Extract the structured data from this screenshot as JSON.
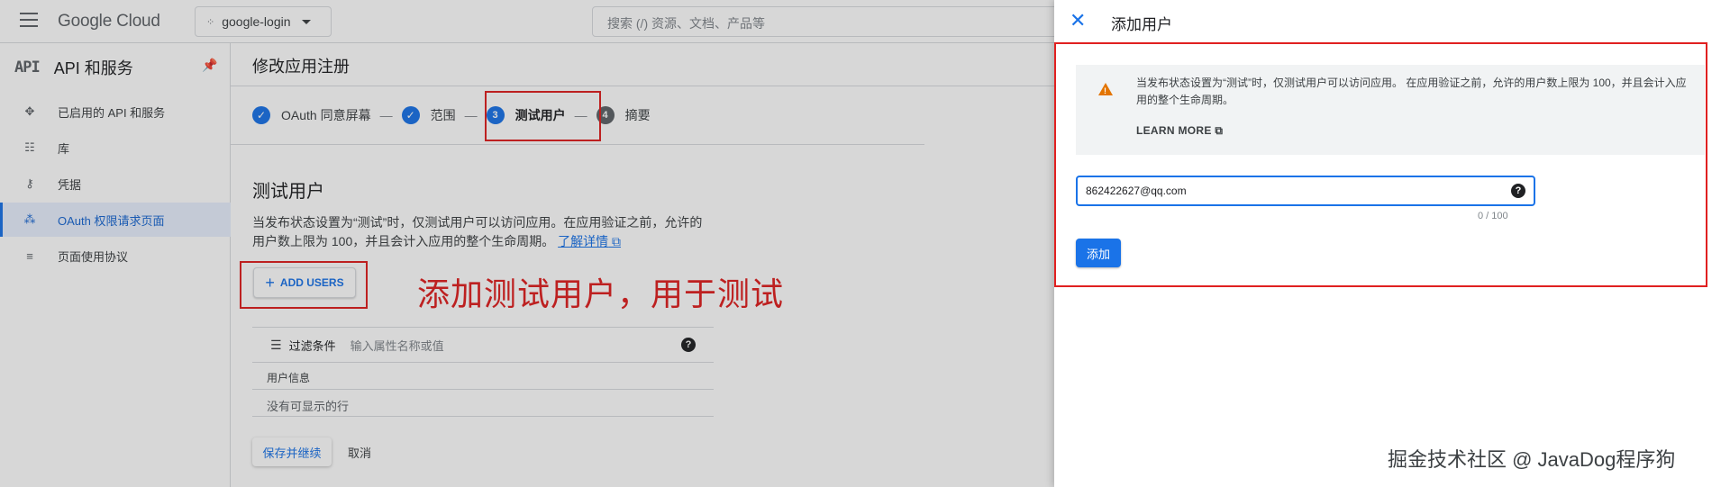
{
  "header": {
    "logo": "Google Cloud",
    "project": "google-login",
    "search_placeholder": "搜索 (/) 资源、文档、产品等"
  },
  "sidebar": {
    "title": "API 和服务",
    "logo_text": "API",
    "items": [
      {
        "label": "已启用的 API 和服务",
        "icon": "dashboard-icon"
      },
      {
        "label": "库",
        "icon": "library-icon"
      },
      {
        "label": "凭据",
        "icon": "key-icon"
      },
      {
        "label": "OAuth 权限请求页面",
        "icon": "oauth-consent-icon",
        "active": true
      },
      {
        "label": "页面使用协议",
        "icon": "page-agreement-icon"
      }
    ]
  },
  "main": {
    "page_title": "修改应用注册",
    "steps": [
      {
        "label": "OAuth 同意屏幕",
        "status": "done"
      },
      {
        "label": "范围",
        "status": "done"
      },
      {
        "num": "3",
        "label": "测试用户",
        "status": "current"
      },
      {
        "num": "4",
        "label": "摘要",
        "status": "pending"
      }
    ],
    "section_title": "测试用户",
    "description": "当发布状态设置为“测试”时，仅测试用户可以访问应用。在应用验证之前，允许的用户数上限为 100，并且会计入应用的整个生命周期。",
    "learn_more_link": "了解详情",
    "add_users_label": "ADD USERS",
    "annotation": "添加测试用户，用于测试",
    "filter_label": "过滤条件",
    "filter_placeholder": "输入属性名称或值",
    "table_header": "用户信息",
    "empty_text": "没有可显示的行",
    "save_label": "保存并继续",
    "cancel_label": "取消"
  },
  "drawer": {
    "title": "添加用户",
    "notice": "当发布状态设置为“测试”时，仅测试用户可以访问应用。 在应用验证之前，允许的用户数上限为 100，并且会计入应用的整个生命周期。",
    "learn_more": "LEARN MORE",
    "email_value": "862422627@qq.com",
    "counter": "0 / 100",
    "add_label": "添加"
  },
  "watermark": "掘金技术社区 @ JavaDog程序狗",
  "colors": {
    "accent": "#1a73e8",
    "annotation_red": "#e02020",
    "warning": "#e37400",
    "step_pending": "#5f6368"
  }
}
